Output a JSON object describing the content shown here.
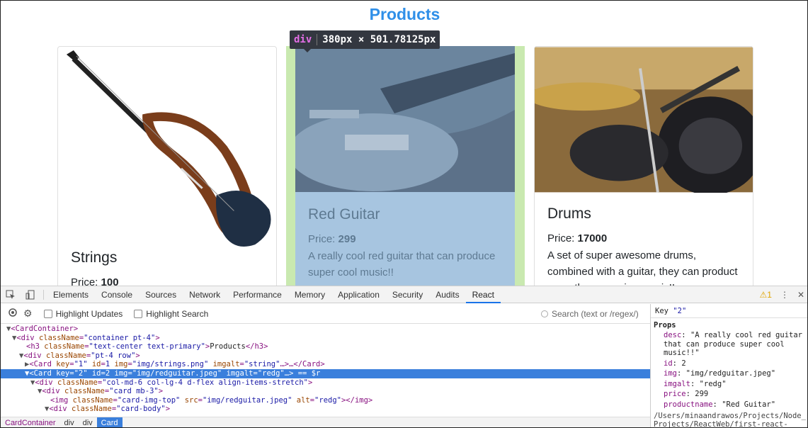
{
  "page": {
    "title": "Products",
    "tooltip": {
      "tag": "div",
      "size": "380px × 501.78125px"
    },
    "cards": [
      {
        "title": "Strings",
        "price_label": "Price:",
        "price": "100",
        "desc": ""
      },
      {
        "title": "Red Guitar",
        "price_label": "Price:",
        "price": "299",
        "desc": "A really cool red guitar that can produce super cool music!!"
      },
      {
        "title": "Drums",
        "price_label": "Price:",
        "price": "17000",
        "desc": "A set of super awesome drums, combined with a guitar, they can product more than amazing music!!"
      }
    ]
  },
  "devtools": {
    "tabs": [
      "Elements",
      "Console",
      "Sources",
      "Network",
      "Performance",
      "Memory",
      "Application",
      "Security",
      "Audits",
      "React"
    ],
    "active_tab": "React",
    "warning_count": "1",
    "toolbar": {
      "highlight_updates": "Highlight Updates",
      "highlight_search": "Highlight Search",
      "search_placeholder": "Search (text or /regex/)"
    },
    "sidebar": {
      "key_label": "Key",
      "key_value": "\"2\"",
      "props_title": "Props",
      "props": [
        {
          "name": "desc",
          "value": "\"A really cool red guitar that can produce super cool music!!\""
        },
        {
          "name": "id",
          "value": "2"
        },
        {
          "name": "img",
          "value": "\"img/redguitar.jpeg\""
        },
        {
          "name": "imgalt",
          "value": "\"redg\""
        },
        {
          "name": "price",
          "value": "299"
        },
        {
          "name": "productname",
          "value": "\"Red Guitar\""
        }
      ],
      "path": "/Users/minaandrawos/Projects/Node_Projects/ReactWeb/first-react-"
    },
    "breadcrumbs": [
      "CardContainer",
      "div",
      "div",
      "Card"
    ]
  },
  "colors": {
    "title_blue": "#2f8fe8",
    "selection": "#3a7fdc",
    "highlight_margin": "#c9e9b0",
    "highlight_content": "#a7c5e0"
  }
}
